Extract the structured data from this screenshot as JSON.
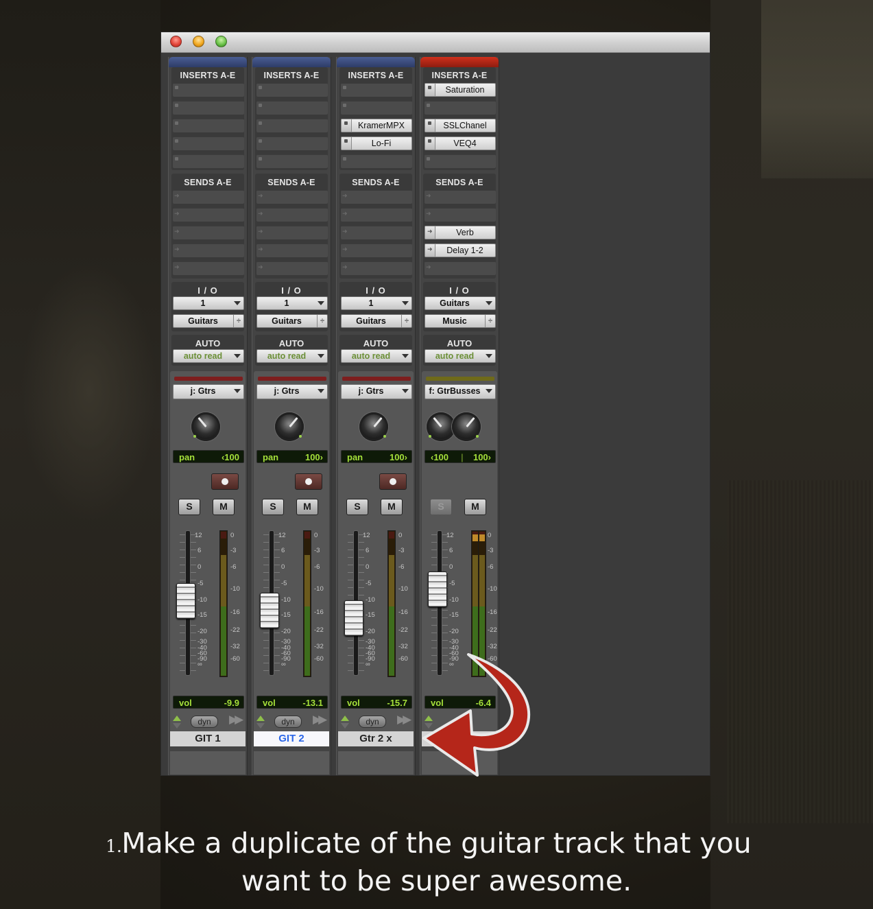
{
  "caption": {
    "number": "1.",
    "line1": "Make a duplicate of the guitar track that you",
    "line2": "want to be super awesome."
  },
  "mixer": {
    "section_labels": {
      "inserts": "INSERTS A-E",
      "sends": "SENDS A-E",
      "io": "I / O",
      "auto": "AUTO"
    },
    "strips": [
      {
        "name": "GIT 1",
        "cap_color": "#3b4d80",
        "inserts": [
          "",
          "",
          "",
          "",
          ""
        ],
        "sends": [
          "",
          "",
          "",
          "",
          ""
        ],
        "io_input": "1",
        "io_output": "Guitars",
        "auto_mode": "auto read",
        "group": "j: Gtrs",
        "group_bar_color": "#7d1e1e",
        "pan_label": "pan",
        "pan_value": "‹100",
        "volume_label": "vol",
        "volume": "-9.9",
        "fader_db": -9.9,
        "dyn_label": "dyn",
        "solo": "S",
        "mute": "M",
        "record": true
      },
      {
        "name": "GIT 2",
        "cap_color": "#3b4d80",
        "inserts": [
          "",
          "",
          "",
          "",
          ""
        ],
        "sends": [
          "",
          "",
          "",
          "",
          ""
        ],
        "io_input": "1",
        "io_output": "Guitars",
        "auto_mode": "auto read",
        "group": "j: Gtrs",
        "group_bar_color": "#7d1e1e",
        "pan_label": "pan",
        "pan_value": "100›",
        "volume_label": "vol",
        "volume": "-13.1",
        "fader_db": -13.1,
        "dyn_label": "dyn",
        "solo": "S",
        "mute": "M",
        "record": true,
        "selected": true
      },
      {
        "name": "Gtr 2 x",
        "cap_color": "#3b4d80",
        "inserts": [
          "",
          "",
          "KramerMPX",
          "Lo-Fi",
          ""
        ],
        "sends": [
          "",
          "",
          "",
          "",
          ""
        ],
        "io_input": "1",
        "io_output": "Guitars",
        "auto_mode": "auto read",
        "group": "j: Gtrs",
        "group_bar_color": "#7d1e1e",
        "pan_label": "pan",
        "pan_value": "100›",
        "volume_label": "vol",
        "volume": "-15.7",
        "fader_db": -15.7,
        "dyn_label": "dyn",
        "solo": "S",
        "mute": "M",
        "record": true
      },
      {
        "name": "",
        "cap_color": "#b8281a",
        "inserts": [
          "Saturation",
          "",
          "SSLChanel",
          "VEQ4",
          ""
        ],
        "sends": [
          "",
          "",
          "Verb",
          "Delay 1-2",
          ""
        ],
        "io_input": "Guitars",
        "io_output": "Music",
        "auto_mode": "auto read",
        "group": "f: GtrBusses",
        "group_bar_color": "#6f6a1a",
        "pan_left": "‹100",
        "pan_right": "100›",
        "volume_label": "vol",
        "volume": "-6.4",
        "fader_db": -6.4,
        "solo": "S",
        "mute": "M",
        "record": false
      }
    ],
    "fader_scale": [
      "12",
      "6",
      "0",
      "-5",
      "-10",
      "-15",
      "-20",
      "-30",
      "-40",
      "-60",
      "-90",
      "∞"
    ],
    "meter_scale": [
      "0",
      "-3",
      "-6",
      "-10",
      "-16",
      "-22",
      "-32",
      "-60"
    ]
  },
  "colors": {
    "lcd_text": "#a5e03a",
    "selected_name": "#2a66e8",
    "arrow": "#b5261a"
  }
}
